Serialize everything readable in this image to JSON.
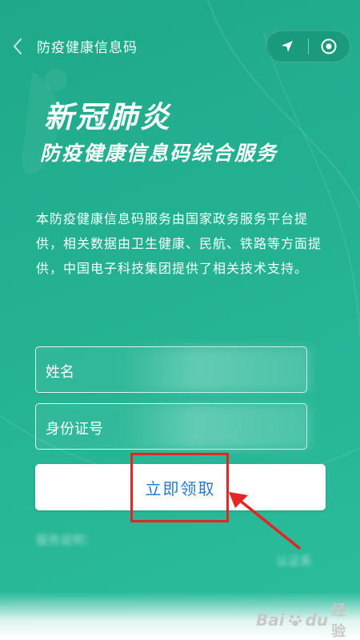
{
  "nav": {
    "back_icon": "chevron-left-icon",
    "title": "防疫健康信息码",
    "capsule_icons": [
      "location-arrow-icon",
      "target-circle-icon"
    ]
  },
  "hero": {
    "line1": "新冠肺炎",
    "line2": "防疫健康信息码综合服务"
  },
  "description": "本防疫健康信息码服务由国家政务服务平台提供，相关数据由卫生健康、民航、铁路等方面提供，中国电子科技集团提供了相关技术支持。",
  "form": {
    "name_label": "姓名",
    "name_value": "",
    "id_label": "身份证号",
    "id_value": ""
  },
  "submit_label": "立即领取",
  "footnotes": {
    "line1": "服务说明：",
    "line2": "认证系"
  },
  "watermark": {
    "brand": "Bai",
    "brand2": "du",
    "suffix": "经验"
  },
  "colors": {
    "background": "#23b091",
    "button_text": "#2a7ac8",
    "highlight": "#e52424"
  }
}
